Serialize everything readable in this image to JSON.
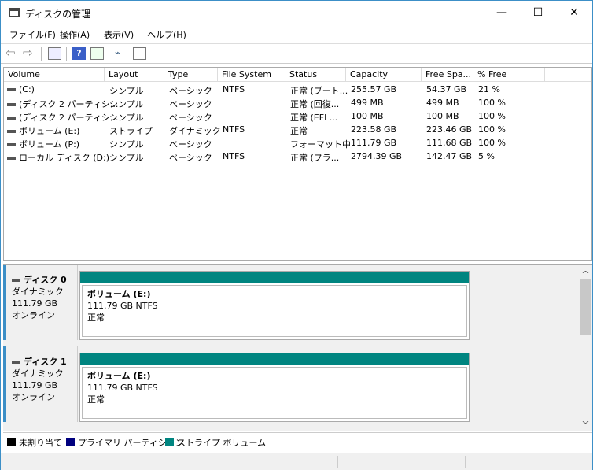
{
  "window": {
    "title": "ディスクの管理",
    "minimize": "—",
    "maximize": "☐",
    "close": "✕"
  },
  "menu": [
    "ファイル(F)",
    "操作(A)",
    "表示(V)",
    "ヘルプ(H)"
  ],
  "toolbar_icons": [
    "back-icon",
    "forward-icon",
    "console-tree-icon",
    "help-icon",
    "action-pane-icon",
    "connect-icon",
    "properties-icon"
  ],
  "columns": [
    "Volume",
    "Layout",
    "Type",
    "File System",
    "Status",
    "Capacity",
    "Free Spa...",
    "% Free"
  ],
  "rows": [
    [
      "(C:)",
      "シンプル",
      "ベーシック",
      "NTFS",
      "正常 (ブート...",
      "255.57 GB",
      "54.37 GB",
      "21 %"
    ],
    [
      "(ディスク 2 パーティシ...",
      "シンプル",
      "ベーシック",
      "",
      "正常 (回復...",
      "499 MB",
      "499 MB",
      "100 %"
    ],
    [
      "(ディスク 2 パーティシ...",
      "シンプル",
      "ベーシック",
      "",
      "正常 (EFI ...",
      "100 MB",
      "100 MB",
      "100 %"
    ],
    [
      "ボリューム (E:)",
      "ストライプ",
      "ダイナミック",
      "NTFS",
      "正常",
      "223.58 GB",
      "223.46 GB",
      "100 %"
    ],
    [
      "ボリューム (P:)",
      "シンプル",
      "ベーシック",
      "",
      "フォーマット中",
      "111.79 GB",
      "111.68 GB",
      "100 %"
    ],
    [
      "ローカル ディスク (D:)",
      "シンプル",
      "ベーシック",
      "NTFS",
      "正常 (プラ...",
      "2794.39 GB",
      "142.47 GB",
      "5 %"
    ]
  ],
  "disks": [
    {
      "name": "ディスク 0",
      "type": "ダイナミック",
      "size": "111.79 GB",
      "state": "オンライン",
      "partition": {
        "name": "ボリューム  (E:)",
        "size": "111.79 GB NTFS",
        "status": "正常"
      }
    },
    {
      "name": "ディスク 1",
      "type": "ダイナミック",
      "size": "111.79 GB",
      "state": "オンライン",
      "partition": {
        "name": "ボリューム  (E:)",
        "size": "111.79 GB NTFS",
        "status": "正常"
      }
    }
  ],
  "legend": [
    {
      "label": "未割り当て",
      "color": "#000000"
    },
    {
      "label": "プライマリ パーティション",
      "color": "#00007f"
    },
    {
      "label": "ストライプ ボリューム",
      "color": "#008580"
    }
  ]
}
